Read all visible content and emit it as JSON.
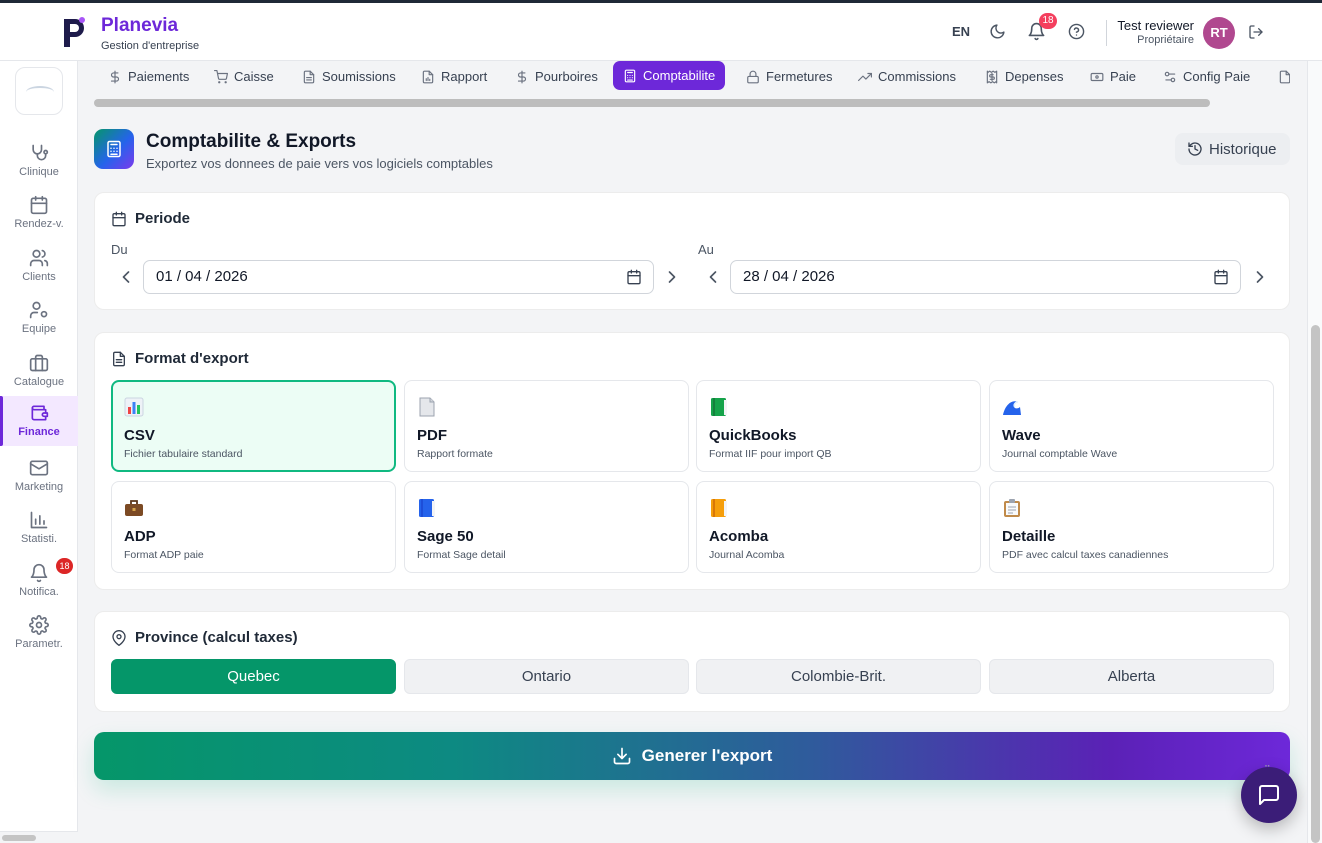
{
  "header": {
    "brand": "Planevia",
    "subtitle": "Gestion d'entreprise",
    "lang": "EN",
    "notifications_count": "18",
    "user_name": "Test reviewer",
    "user_role": "Propriétaire",
    "avatar_initials": "RT"
  },
  "sidebar": {
    "items": [
      {
        "label": "Clinique",
        "icon": "stethoscope-icon"
      },
      {
        "label": "Rendez-v.",
        "icon": "calendar-icon"
      },
      {
        "label": "Clients",
        "icon": "users-icon"
      },
      {
        "label": "Equipe",
        "icon": "user-cog-icon"
      },
      {
        "label": "Catalogue",
        "icon": "briefcase-icon"
      },
      {
        "label": "Finance",
        "icon": "wallet-icon"
      },
      {
        "label": "Marketing",
        "icon": "mail-icon"
      },
      {
        "label": "Statisti.",
        "icon": "bar-chart-icon"
      },
      {
        "label": "Notifica.",
        "icon": "bell-icon"
      },
      {
        "label": "Parametr.",
        "icon": "gear-icon"
      }
    ],
    "active": "Finance",
    "notifications_badge": "18"
  },
  "tabs": [
    {
      "label": "Paiements",
      "icon": "dollar-icon"
    },
    {
      "label": "Caisse",
      "icon": "cart-icon"
    },
    {
      "label": "Soumissions",
      "icon": "document-icon"
    },
    {
      "label": "Rapport",
      "icon": "report-icon"
    },
    {
      "label": "Pourboires",
      "icon": "dollar-icon"
    },
    {
      "label": "Comptabilite",
      "icon": "calculator-icon"
    },
    {
      "label": "Fermetures",
      "icon": "lock-icon"
    },
    {
      "label": "Commissions",
      "icon": "trend-icon"
    },
    {
      "label": "Depenses",
      "icon": "receipt-icon"
    },
    {
      "label": "Paie",
      "icon": "banknote-icon"
    },
    {
      "label": "Config Paie",
      "icon": "sliders-icon"
    }
  ],
  "active_tab": "Comptabilite",
  "page": {
    "title": "Comptabilite & Exports",
    "subtitle": "Exportez vos donnees de paie vers vos logiciels comptables",
    "history_label": "Historique"
  },
  "period": {
    "title": "Periode",
    "from_label": "Du",
    "from_value": "01 / 04 / 2026",
    "to_label": "Au",
    "to_value": "28 / 04 / 2026"
  },
  "export_format": {
    "title": "Format d'export",
    "selected": "CSV",
    "formats": [
      {
        "name": "CSV",
        "desc": "Fichier tabulaire standard",
        "icon": "bar-chart-emoji"
      },
      {
        "name": "PDF",
        "desc": "Rapport formate",
        "icon": "page-emoji"
      },
      {
        "name": "QuickBooks",
        "desc": "Format IIF pour import QB",
        "icon": "green-book-emoji"
      },
      {
        "name": "Wave",
        "desc": "Journal comptable Wave",
        "icon": "wave-emoji"
      },
      {
        "name": "ADP",
        "desc": "Format ADP paie",
        "icon": "briefcase-emoji"
      },
      {
        "name": "Sage 50",
        "desc": "Format Sage detail",
        "icon": "blue-book-emoji"
      },
      {
        "name": "Acomba",
        "desc": "Journal Acomba",
        "icon": "orange-book-emoji"
      },
      {
        "name": "Detaille",
        "desc": "PDF avec calcul taxes canadiennes",
        "icon": "clipboard-emoji"
      }
    ]
  },
  "province": {
    "title": "Province (calcul taxes)",
    "options": [
      "Quebec",
      "Ontario",
      "Colombie-Brit.",
      "Alberta"
    ],
    "selected": "Quebec"
  },
  "generate_label": "Generer l'export",
  "colors": {
    "brand_purple": "#6d28d9",
    "success_green": "#059669",
    "badge_red": "#f43f5e"
  }
}
